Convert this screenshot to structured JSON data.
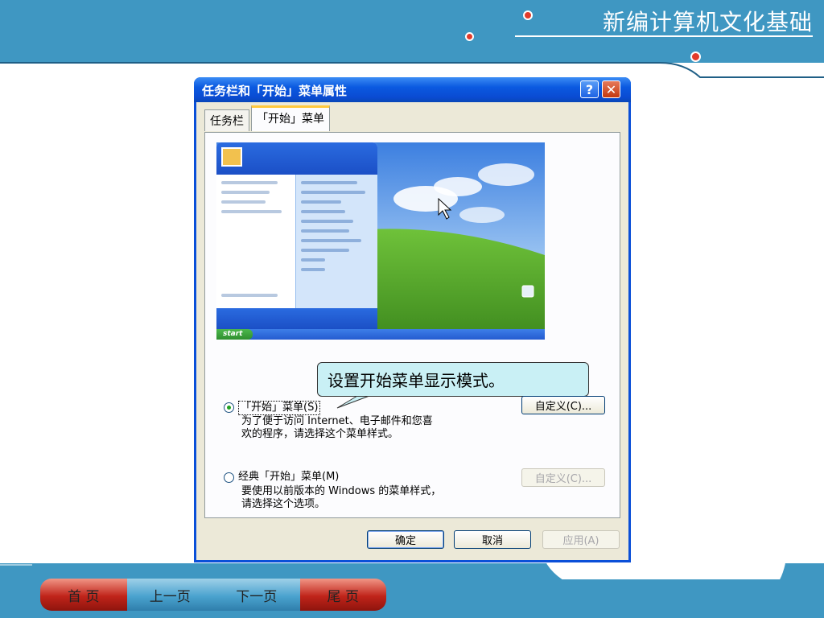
{
  "slide": {
    "title": "新编计算机文化基础",
    "nav": [
      "首 页",
      "上一页",
      "下一页",
      "尾 页"
    ]
  },
  "dialog": {
    "title": "任务栏和「开始」菜单属性",
    "help_label": "?",
    "close_label": "✕",
    "tabs": [
      "任务栏",
      "「开始」菜单"
    ],
    "active_tab": 1,
    "preview": {
      "start_label": "start",
      "menu_right_items": [
        "Mine dokumenter",
        "Mine siste dokumenter",
        "Mine bilder",
        "Min musikk",
        "Min datamaskin",
        "Kontrollpanel",
        "Skrivere og telefakser",
        "Hjelp og støtte",
        "Søk",
        "Kjør..."
      ],
      "menu_left_items": [
        "Internett",
        "E-post",
        "MSN Explorer",
        "Senter for overføring av filer og innstillinger"
      ],
      "all_programs": "Alle programmer"
    },
    "callout": "设置开始菜单显示模式。",
    "options": [
      {
        "label": "「开始」菜单(S)",
        "desc_line1": "为了便于访问 Internet、电子邮件和您喜",
        "desc_line2": "欢的程序，请选择这个菜单样式。",
        "selected": true,
        "customize": "自定义(C)..."
      },
      {
        "label": "经典「开始」菜单(M)",
        "desc_line1": "要使用以前版本的 Windows 的菜单样式，",
        "desc_line2": "请选择这个选项。",
        "selected": false,
        "customize": "自定义(C)..."
      }
    ],
    "buttons": {
      "ok": "确定",
      "cancel": "取消",
      "apply": "应用(A)"
    }
  },
  "colors": {
    "band": "#3f97c2",
    "accent_red": "#e23b2b",
    "xp_title": "#0b59e0"
  }
}
